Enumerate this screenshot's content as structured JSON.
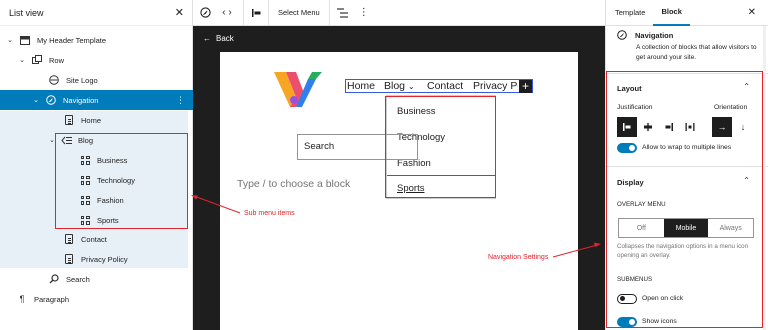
{
  "list_view": {
    "title": "List view",
    "rows": [
      {
        "label": "My Header Template"
      },
      {
        "label": "Row"
      },
      {
        "label": "Site Logo"
      },
      {
        "label": "Navigation"
      },
      {
        "label": "Home"
      },
      {
        "label": "Blog"
      },
      {
        "label": "Business"
      },
      {
        "label": "Technology"
      },
      {
        "label": "Fashion"
      },
      {
        "label": "Sports"
      },
      {
        "label": "Contact"
      },
      {
        "label": "Privacy Policy"
      },
      {
        "label": "Search"
      },
      {
        "label": "Paragraph"
      }
    ]
  },
  "annotations": {
    "submenu_items": "Sub menu items",
    "navigation_settings": "Navigation Settings"
  },
  "toolbar": {
    "select_menu": "Select Menu"
  },
  "canvas": {
    "back_label": "Back",
    "nav_items": [
      "Home",
      "Blog",
      "Contact",
      "Privacy Po"
    ],
    "submenu": [
      "Business",
      "Technology",
      "Fashion",
      "Sports"
    ],
    "search_label": "Search",
    "placeholder": "Type / to choose a block"
  },
  "settings": {
    "tabs": [
      "Template",
      "Block"
    ],
    "block_title": "Navigation",
    "block_desc": "A collection of blocks that allow visitors to get around your site.",
    "layout": {
      "title": "Layout",
      "justification_label": "Justification",
      "orientation_label": "Orientation",
      "wrap_label": "Allow to wrap to multiple lines"
    },
    "display": {
      "title": "Display",
      "overlay_menu_label": "OVERLAY MENU",
      "overlay_options": [
        "Off",
        "Mobile",
        "Always"
      ],
      "overlay_selected": "Mobile",
      "overlay_help": "Collapses the navigation options in a menu icon opening an overlay.",
      "submenus_label": "SUBMENUS",
      "open_on_click": "Open on click",
      "show_icons": "Show icons"
    }
  },
  "colors": {
    "accent": "#007cba",
    "annotation": "#e3242b",
    "canvas_bg": "#1e1e1e"
  }
}
